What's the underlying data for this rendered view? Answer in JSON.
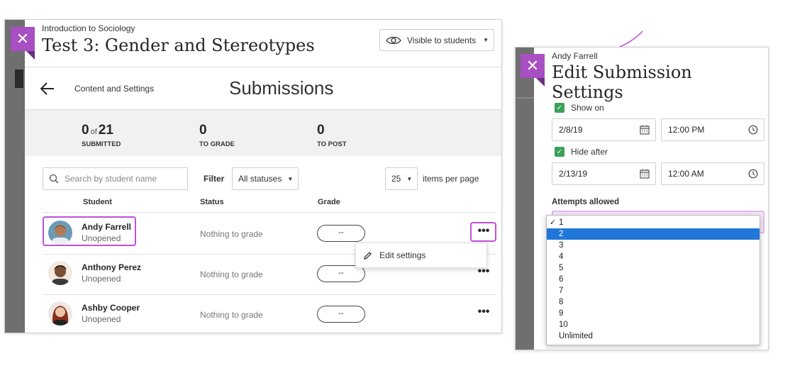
{
  "course": {
    "name": "Introduction to Sociology",
    "test_title": "Test 3: Gender and Stereotypes"
  },
  "visibility": {
    "label": "Visible to students",
    "icon": "eye-icon"
  },
  "nav": {
    "back_icon": "arrow-left-icon",
    "breadcrumb": "Content and Settings",
    "page_title": "Submissions"
  },
  "stats": {
    "submitted": {
      "count": "0",
      "of": "of",
      "total": "21",
      "label": "SUBMITTED"
    },
    "to_grade": {
      "count": "0",
      "label": "TO GRADE"
    },
    "to_post": {
      "count": "0",
      "label": "TO POST"
    }
  },
  "toolbar": {
    "search_placeholder": "Search by student name",
    "filter_label": "Filter",
    "filter_value": "All statuses",
    "per_page_value": "25",
    "per_page_label": "items per page"
  },
  "table": {
    "headers": {
      "student": "Student",
      "status": "Status",
      "grade": "Grade"
    },
    "rows": [
      {
        "name": "Andy Farrell",
        "state": "Unopened",
        "status": "Nothing to grade",
        "grade": "--"
      },
      {
        "name": "Anthony Perez",
        "state": "Unopened",
        "status": "Nothing to grade",
        "grade": "--"
      },
      {
        "name": "Ashby Cooper",
        "state": "Unopened",
        "status": "Nothing to grade",
        "grade": "--"
      }
    ]
  },
  "context_menu": {
    "edit_label": "Edit settings",
    "icon": "pencil-icon"
  },
  "submission_settings": {
    "user": "Andy Farrell",
    "title": "Edit Submission Settings",
    "show_on": {
      "label": "Show on",
      "checked": true,
      "date": "2/8/19",
      "time": "12:00 PM"
    },
    "hide_after": {
      "label": "Hide after",
      "checked": true,
      "date": "2/13/19",
      "time": "12:00 AM"
    },
    "attempts_label": "Attempts allowed",
    "attempts_options": [
      "1",
      "2",
      "3",
      "4",
      "5",
      "6",
      "7",
      "8",
      "9",
      "10",
      "Unlimited"
    ],
    "attempts_checked": "1",
    "attempts_highlighted": "2",
    "check_mark": "✓"
  },
  "colors": {
    "accent": "#a84fc3",
    "highlight": "#c24fd9",
    "checkbox": "#3aa05a",
    "select": "#2176d9"
  }
}
